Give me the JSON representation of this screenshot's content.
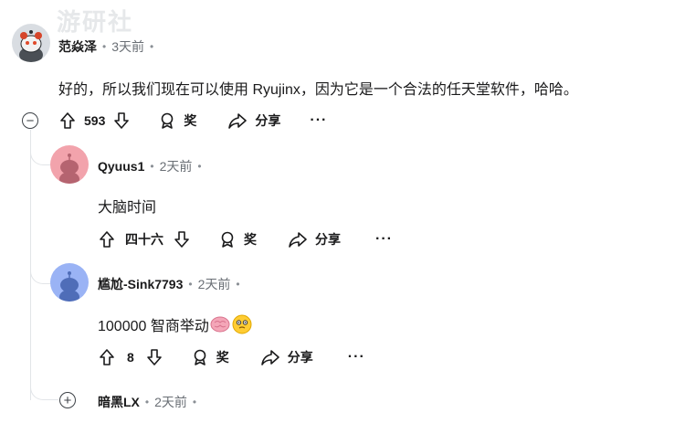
{
  "comments": [
    {
      "author": "范焱泽",
      "time": "3天前",
      "body": "好的，所以我们现在可以使用 Ryujinx，因为它是一个合法的任天堂软件，哈哈。",
      "score": "593",
      "award_label": "奖",
      "share_label": "分享",
      "more": "···",
      "avatar_color": "#d9dde2"
    },
    {
      "author": "Qyuus1",
      "time": "2天前",
      "body": "大脑时间",
      "score": "四十六",
      "award_label": "奖",
      "share_label": "分享",
      "more": "···",
      "avatar_color": "#f2a3ac"
    },
    {
      "author": "尴尬-Sink7793",
      "time": "2天前",
      "body": "100000 智商举动",
      "score": "8",
      "award_label": "奖",
      "share_label": "分享",
      "more": "···",
      "avatar_color": "#9ab3f5"
    },
    {
      "author": "暗黑LX",
      "time": "2天前"
    }
  ],
  "separator": "•",
  "collapse_symbol": "−",
  "expand_symbol": "+",
  "watermark": "游研社"
}
